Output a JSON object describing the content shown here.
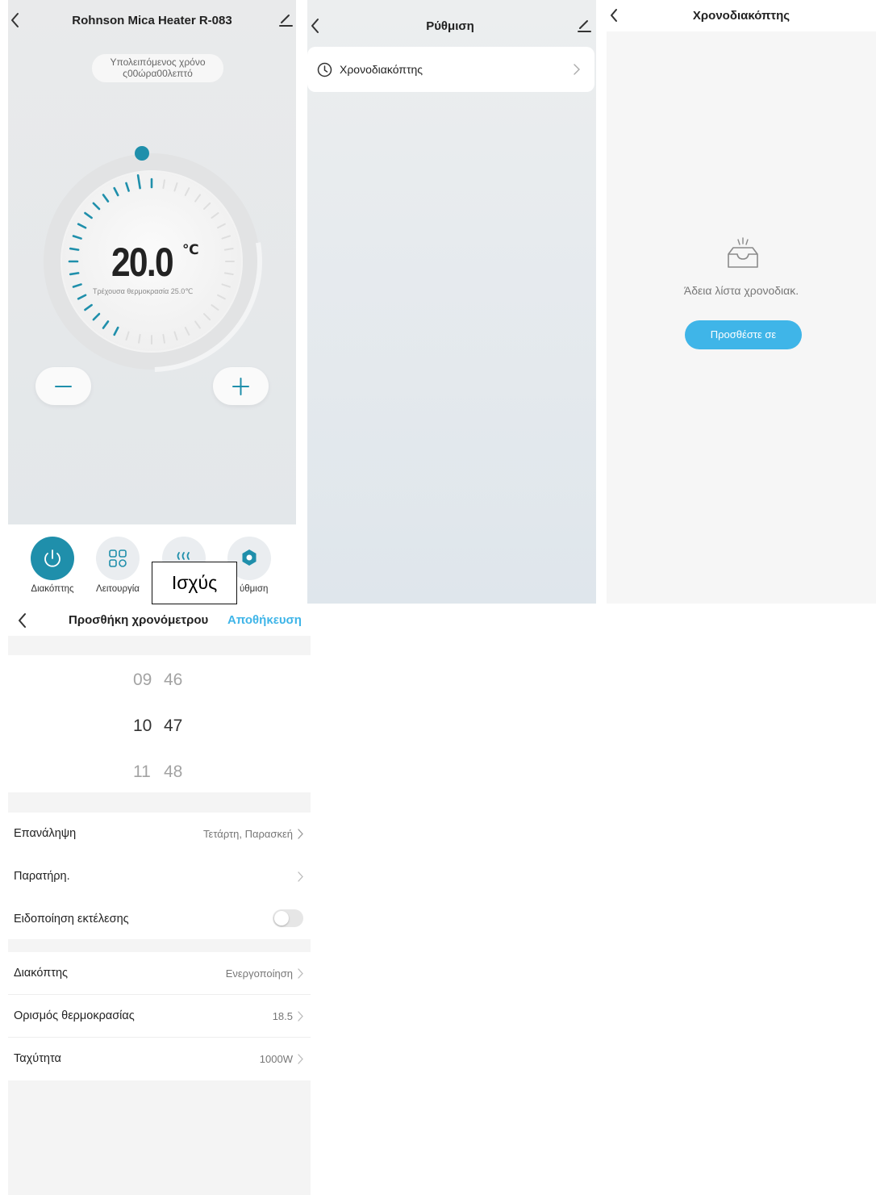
{
  "device_panel": {
    "title": "Rohnson Mica Heater R-083",
    "remaining_line1": "Υπολειπόμενος χρόνο",
    "remaining_line2": "ς00ώρα00λεπτό",
    "set_temperature": "20.0",
    "temperature_unit": "℃",
    "current_temperature": "Τρέχουσα θερμοκρασία 25.0℃",
    "nav": {
      "switch_label": "Διακόπτης",
      "mode_label": "Λειτουργία",
      "power_tooltip": "Ισχύς",
      "settings_label_partial": "ύθμιση"
    },
    "accent_color": "#1f8fab"
  },
  "settings_panel": {
    "title": "Ρύθμιση",
    "items": [
      {
        "label": "Χρονοδιακόπτης"
      }
    ]
  },
  "timer_list_panel": {
    "title": "Χρονοδιακόπτης",
    "empty_text": "Άδεια λίστα χρονοδιακ.",
    "add_button": "Προσθέστε σε",
    "button_color": "#3fb5e8"
  },
  "add_timer_panel": {
    "title": "Προσθήκη χρονόμετρου",
    "save_label": "Αποθήκευση",
    "save_color": "#3fb5e8",
    "picker": {
      "hours": [
        "09",
        "10",
        "11"
      ],
      "minutes": [
        "46",
        "47",
        "48"
      ]
    },
    "repeat": {
      "label": "Επανάληψη",
      "value": "Τετάρτη, Παρασκεή"
    },
    "note": {
      "label": "Παρατήρη.",
      "value": ""
    },
    "notification": {
      "label": "Ειδοποίηση εκτέλεσης",
      "enabled": false
    },
    "switch": {
      "label": "Διακόπτης",
      "value": "Ενεργοποίηση"
    },
    "temperature": {
      "label": "Ορισμός θερμοκρασίας",
      "value": "18.5"
    },
    "speed": {
      "label": "Ταχύτητα",
      "value": "1000W"
    }
  }
}
